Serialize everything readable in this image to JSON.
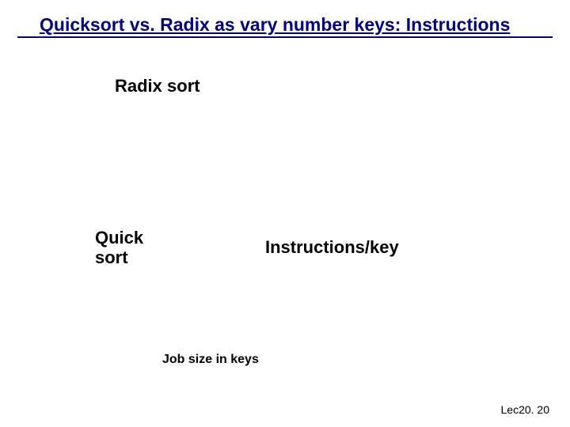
{
  "title": "Quicksort vs. Radix as vary number keys: Instructions",
  "labels": {
    "radix": "Radix sort",
    "quick_line1": "Quick",
    "quick_line2": "sort",
    "instructions_per_key": "Instructions/key",
    "job_size": "Job size in keys"
  },
  "footer": "Lec20. 20"
}
